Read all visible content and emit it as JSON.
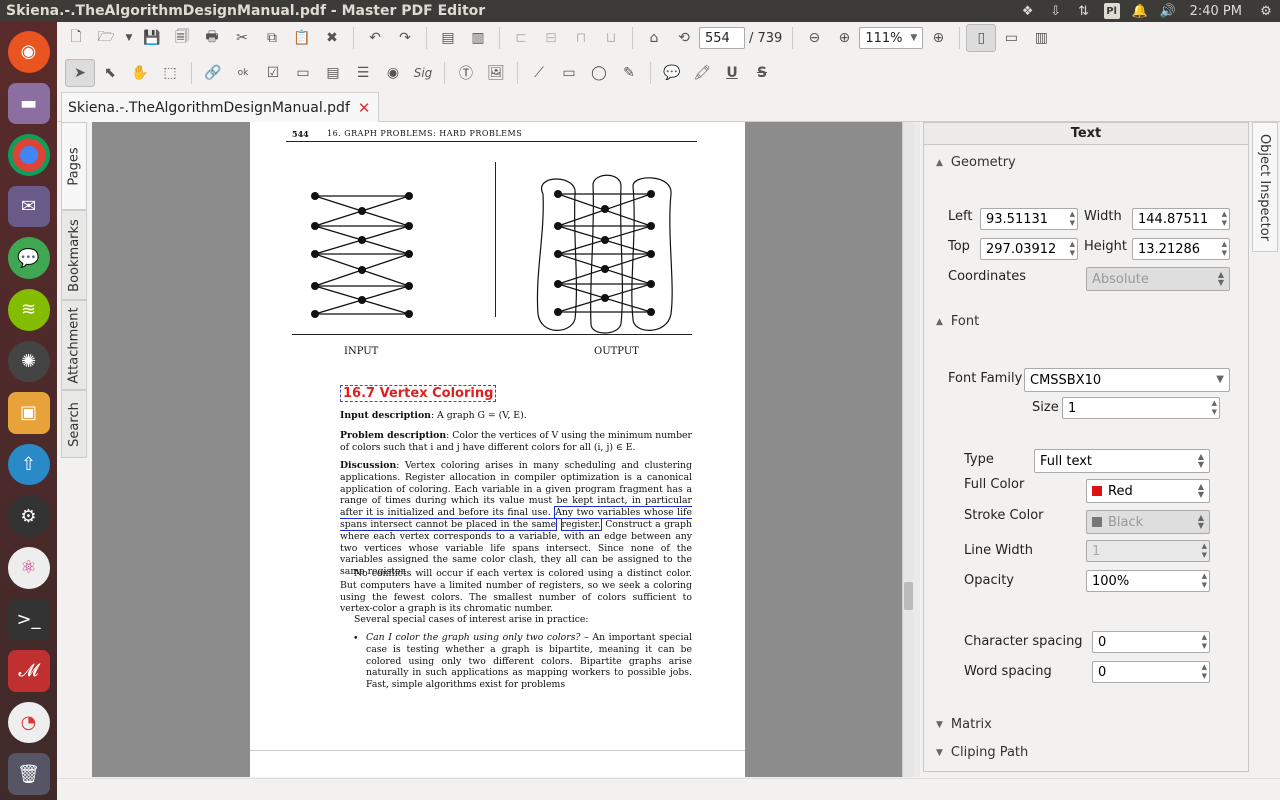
{
  "window_title": "Skiena.-.TheAlgorithmDesignManual.pdf - Master PDF Editor",
  "tray": {
    "indicator_pl": "Pl",
    "clock": "2:40 PM"
  },
  "toolbar": {
    "page_current": "554",
    "page_total": "/ 739",
    "zoom": "111%"
  },
  "tab": {
    "name": "Skiena.-.TheAlgorithmDesignManual.pdf",
    "close": "✕"
  },
  "sidetabs": {
    "pages": "Pages",
    "bookmarks": "Bookmarks",
    "attachment": "Attachment",
    "search": "Search"
  },
  "page": {
    "header_num": "544",
    "header_text": "16.  GRAPH PROBLEMS: HARD PROBLEMS",
    "caption_input": "INPUT",
    "caption_output": "OUTPUT",
    "section_title": "16.7    Vertex Coloring",
    "input_desc_label": "Input description",
    "input_desc_text": ": A graph G = (V, E).",
    "problem_label": "Problem description",
    "problem_text": ": Color the vertices of V using the minimum number of colors such that i and j have different colors for all (i, j) ∈ E.",
    "discussion_label": "Discussion",
    "discussion_text1": ": Vertex coloring arises in many scheduling and clustering applications. Register allocation in compiler optimization is a canonical application of coloring. Each variable in a given program fragment has a range of times during which its value must be kept intact, in particular after it is initialized and before its final use. ",
    "discussion_hl": "Any two variables whose life spans intersect cannot be placed in the same",
    "discussion_hl2": "register.",
    "discussion_text2": " Construct a graph where each vertex corresponds to a variable, with an edge between any two vertices whose variable life spans intersect. Since none of the variables assigned the same color clash, they all can be assigned to the same register.",
    "para2": "No conflicts will occur if each vertex is colored using a distinct color. But computers have a limited number of registers, so we seek a coloring using the fewest colors. The smallest number of colors sufficient to vertex-color a graph is its chromatic number.",
    "para3": "Several special cases of interest arise in practice:",
    "bullet_q": "Can I color the graph using only two colors?",
    "bullet_text": " – An important special case is testing whether a graph is bipartite, meaning it can be colored using only two different colors. Bipartite graphs arise naturally in such applications as mapping workers to possible jobs. Fast, simple algorithms exist for problems"
  },
  "inspector": {
    "header": "Text",
    "tab_label": "Object Inspector",
    "geometry": "Geometry",
    "left_label": "Left",
    "left_value": "93.51131",
    "width_label": "Width",
    "width_value": "144.87511",
    "top_label": "Top",
    "top_value": "297.03912",
    "height_label": "Height",
    "height_value": "13.21286",
    "coords_label": "Coordinates",
    "coords_value": "Absolute",
    "font": "Font",
    "font_family_label": "Font Family",
    "font_family_value": "CMSSBX10",
    "size_label": "Size",
    "size_value": "1",
    "type_label": "Type",
    "type_value": "Full text",
    "full_color_label": "Full Color",
    "full_color_value": "Red",
    "full_color_hex": "#e01010",
    "stroke_color_label": "Stroke Color",
    "stroke_color_value": "Black",
    "line_width_label": "Line Width",
    "line_width_value": "1",
    "opacity_label": "Opacity",
    "opacity_value": "100%",
    "char_spacing_label": "Character spacing",
    "char_spacing_value": "0",
    "word_spacing_label": "Word spacing",
    "word_spacing_value": "0",
    "matrix": "Matrix",
    "clipping": "Cliping Path"
  }
}
